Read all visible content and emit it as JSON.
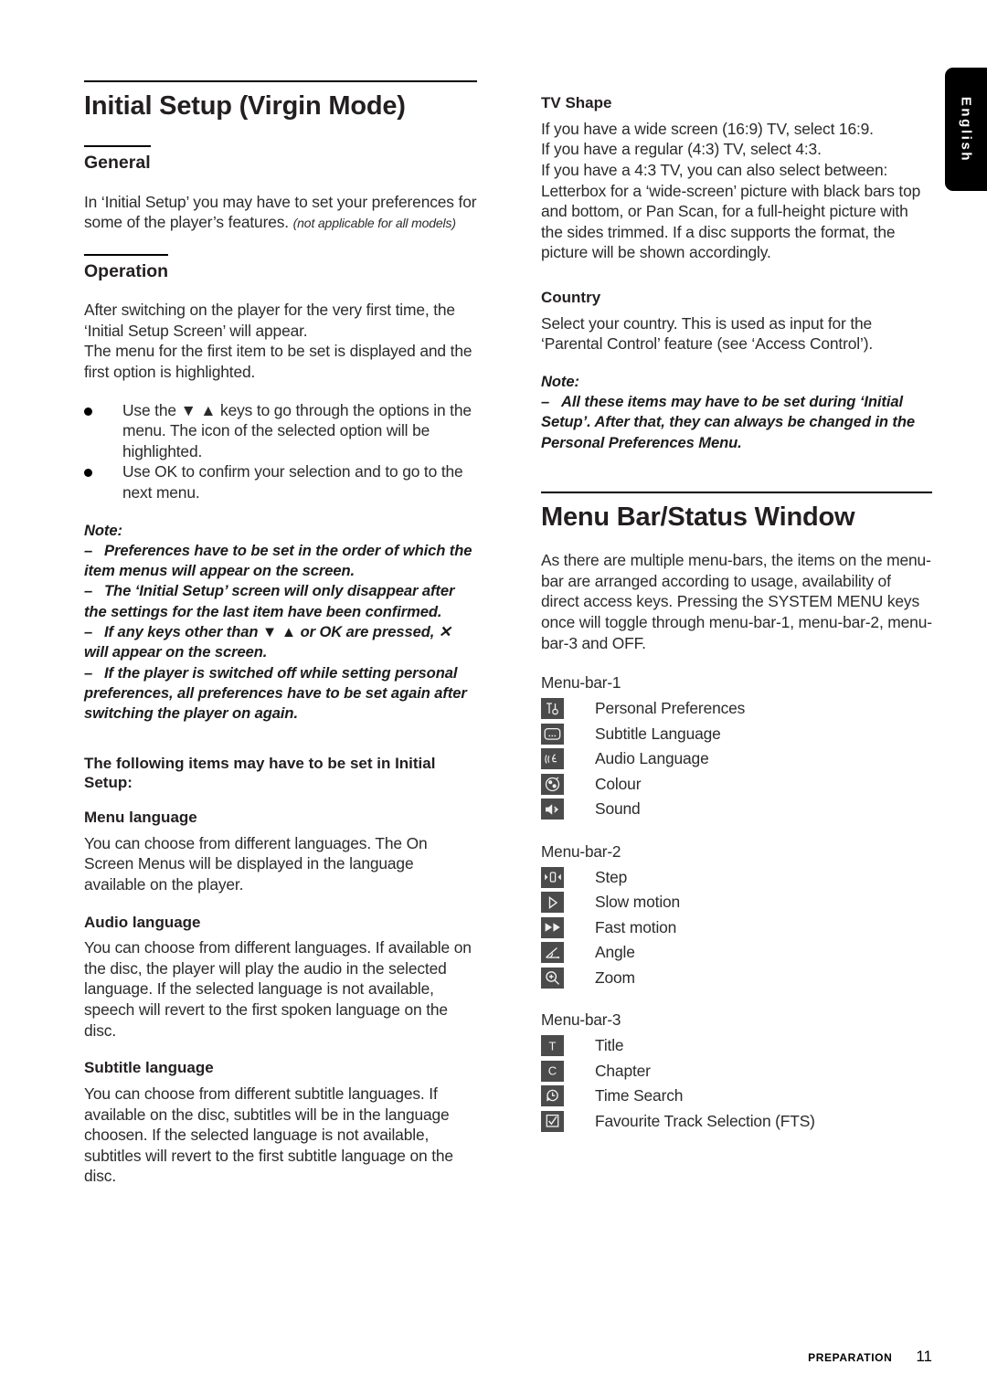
{
  "lang_tab": {
    "label": "English"
  },
  "left": {
    "title": "Initial Setup (Virgin Mode)",
    "general": {
      "heading": "General",
      "body": "In ‘Initial Setup’ you may have to set your preferences for some of the player’s features.",
      "body_italic": "(not applicable for all models)"
    },
    "operation": {
      "heading": "Operation",
      "p1": "After switching on the player for the very first time, the ‘Initial Setup Screen’ will appear.\nThe menu for the first item to be set is displayed and the first option is highlighted.",
      "bullets": [
        "Use the ▼ ▲ keys to go through the options in the menu. The icon of the selected option will be highlighted.",
        "Use OK to confirm your selection and to go to the next menu."
      ],
      "note_label": "Note:",
      "notes": [
        "Preferences have to be set in the order of which the item menus will appear on the screen.",
        "The ‘Initial Setup’ screen will only disappear after the settings for the last item have been confirmed.",
        "If any keys other than ▼ ▲ or OK are pressed, ✕ will appear on the screen.",
        "If the player is switched off while setting personal preferences, all preferences have to be set again after switching the player on again."
      ]
    },
    "items_intro": "The following items may have to be set in Initial Setup:",
    "sections": [
      {
        "heading": "Menu language",
        "body": "You can choose from different languages. The On Screen Menus will be displayed in the language available on the player."
      },
      {
        "heading": "Audio language",
        "body": "You can choose from different languages. If available on the disc, the player will play the audio in the selected language. If the selected language is not available, speech will revert to the first spoken language on the disc."
      },
      {
        "heading": "Subtitle language",
        "body": "You can choose from different subtitle languages. If available on the disc, subtitles will be in the language choosen. If the selected language is not available, subtitles will revert to the first subtitle language on the disc."
      }
    ]
  },
  "right": {
    "tv_shape": {
      "heading": "TV Shape",
      "body": "If you have a wide screen (16:9) TV, select 16:9.\nIf you have a regular (4:3) TV, select 4:3.\nIf you have a 4:3 TV, you can also select between:\nLetterbox for a ‘wide-screen’ picture with black bars top and bottom, or Pan Scan, for a full-height picture with the sides trimmed. If a disc supports the format, the picture will be shown accordingly."
    },
    "country": {
      "heading": "Country",
      "body": "Select your country. This is used as input for the ‘Parental Control’ feature (see ‘Access Control’).",
      "note_label": "Note:",
      "notes": [
        "All these items may have to be set during ‘Initial Setup’. After that, they can always be changed in the Personal Preferences Menu."
      ]
    },
    "menu_bar": {
      "title": "Menu Bar/Status Window",
      "body": "As there are multiple menu-bars, the items on the menu-bar are arranged according to usage, availability of direct access keys. Pressing the SYSTEM MENU keys once will toggle through menu-bar-1, menu-bar-2, menu-bar-3 and OFF.",
      "groups": [
        {
          "label": "Menu-bar-1",
          "items": [
            {
              "icon": "tools-icon",
              "label": "Personal Preferences"
            },
            {
              "icon": "subtitle-icon",
              "label": "Subtitle Language"
            },
            {
              "icon": "audio-language-icon",
              "label": "Audio Language"
            },
            {
              "icon": "colour-icon",
              "label": "Colour"
            },
            {
              "icon": "sound-icon",
              "label": "Sound"
            }
          ]
        },
        {
          "label": "Menu-bar-2",
          "items": [
            {
              "icon": "step-icon",
              "label": "Step"
            },
            {
              "icon": "slow-motion-icon",
              "label": "Slow motion"
            },
            {
              "icon": "fast-motion-icon",
              "label": "Fast motion"
            },
            {
              "icon": "angle-icon",
              "label": "Angle"
            },
            {
              "icon": "zoom-icon",
              "label": "Zoom"
            }
          ]
        },
        {
          "label": "Menu-bar-3",
          "items": [
            {
              "icon": "title-icon",
              "label": "Title"
            },
            {
              "icon": "chapter-icon",
              "label": "Chapter"
            },
            {
              "icon": "time-search-icon",
              "label": "Time Search"
            },
            {
              "icon": "fts-icon",
              "label": "Favourite Track Selection (FTS)"
            }
          ]
        }
      ]
    }
  },
  "footer": {
    "chapter": "Preparation",
    "page": "11"
  },
  "colors": {
    "icon_bg": "#4b4b4b",
    "tab_bg": "#000000",
    "text": "#2b2b2b"
  }
}
